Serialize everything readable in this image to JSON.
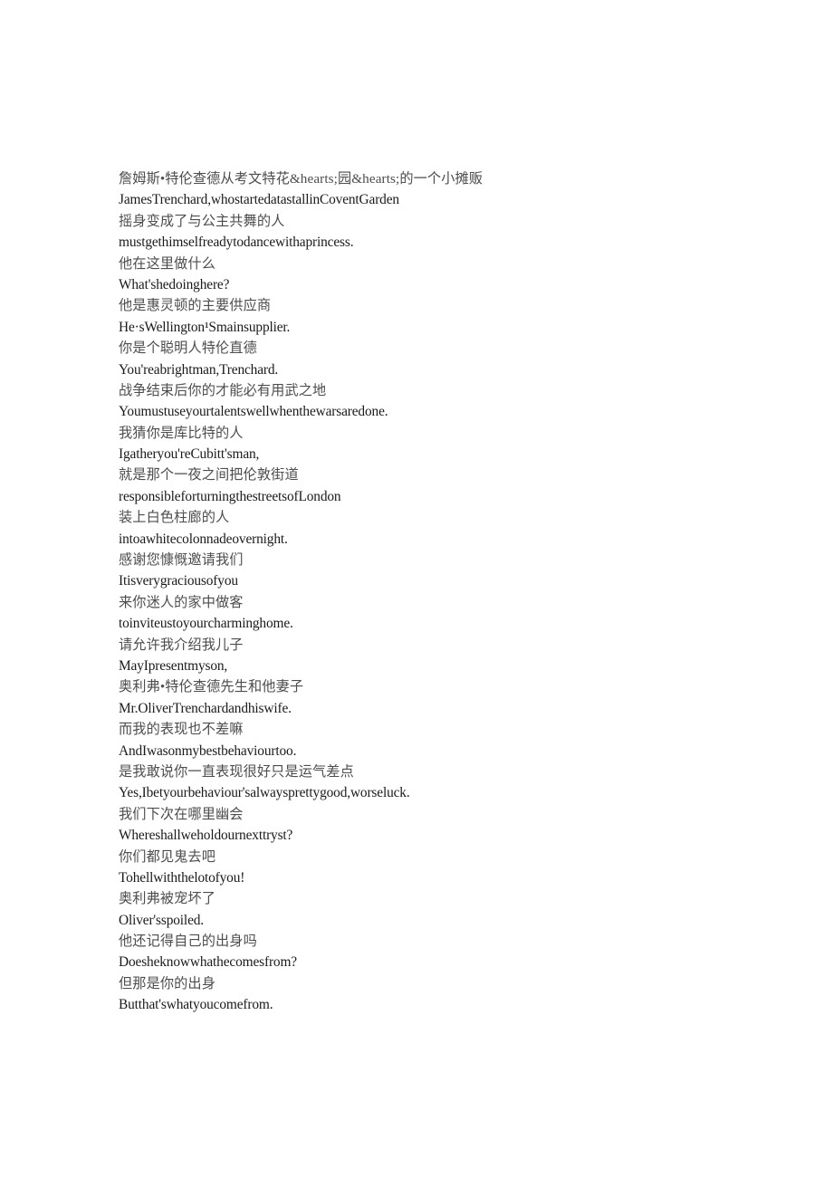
{
  "document": {
    "type": "bilingual-subtitle-transcript",
    "background_color": "#ffffff",
    "zh_text_color": "#4d4d4d",
    "en_text_color": "#1a1a1a",
    "lines": [
      {
        "lang": "zh",
        "text": "詹姆斯•特伦查德从考文特花&hearts;园&hearts;的一个小摊贩"
      },
      {
        "lang": "en",
        "text": "JamesTrenchard,whostartedatastallinCoventGarden"
      },
      {
        "lang": "zh",
        "text": "摇身变成了与公主共舞的人"
      },
      {
        "lang": "en",
        "text": "mustgethimselfreadytodancewithaprincess."
      },
      {
        "lang": "zh",
        "text": "他在这里做什么"
      },
      {
        "lang": "en",
        "text": "What'shedoinghere?"
      },
      {
        "lang": "zh",
        "text": "他是惠灵顿的主要供应商"
      },
      {
        "lang": "en",
        "text": "He·sWellington¹Smainsupplier."
      },
      {
        "lang": "zh",
        "text": "你是个聪明人特伦直德"
      },
      {
        "lang": "en",
        "text": "You'reabrightman,Trenchard."
      },
      {
        "lang": "zh",
        "text": "战争结束后你的才能必有用武之地"
      },
      {
        "lang": "en",
        "text": "Youmustuseyourtalentswellwhenthewarsaredone."
      },
      {
        "lang": "zh",
        "text": "我猜你是库比特的人"
      },
      {
        "lang": "en",
        "text": "Igatheryou'reCubitt'sman,"
      },
      {
        "lang": "zh",
        "text": "就是那个一夜之间把伦敦街道"
      },
      {
        "lang": "en",
        "text": "responsibleforturningthestreetsofLondon"
      },
      {
        "lang": "zh",
        "text": "装上白色柱廊的人"
      },
      {
        "lang": "en",
        "text": "intoawhitecolonnadeovernight."
      },
      {
        "lang": "zh",
        "text": "感谢您慷慨邀请我们"
      },
      {
        "lang": "en",
        "text": "Itisverygraciousofyou"
      },
      {
        "lang": "zh",
        "text": "来你迷人的家中做客"
      },
      {
        "lang": "en",
        "text": "toinviteustoyourcharminghome."
      },
      {
        "lang": "zh",
        "text": "请允许我介绍我儿子"
      },
      {
        "lang": "en",
        "text": "MayIpresentmyson,"
      },
      {
        "lang": "zh",
        "text": "奥利弗•特伦查德先生和他妻子"
      },
      {
        "lang": "en",
        "text": "Mr.OliverTrenchardandhiswife."
      },
      {
        "lang": "zh",
        "text": "而我的表现也不差嘛"
      },
      {
        "lang": "en",
        "text": "AndIwasonmybestbehaviourtoo."
      },
      {
        "lang": "zh",
        "text": "是我敢说你一直表现很好只是运气差点"
      },
      {
        "lang": "en",
        "text": "Yes,Ibetyourbehaviour'salwaysprettygood,worseluck."
      },
      {
        "lang": "zh",
        "text": "我们下次在哪里幽会"
      },
      {
        "lang": "en",
        "text": "Whereshallweholdournexttryst?"
      },
      {
        "lang": "zh",
        "text": "你们都见鬼去吧"
      },
      {
        "lang": "en",
        "text": "Tohellwiththelotofyou!"
      },
      {
        "lang": "zh",
        "text": "奥利弗被宠坏了"
      },
      {
        "lang": "en",
        "text": "Oliver'sspoiled."
      },
      {
        "lang": "zh",
        "text": "他还记得自己的出身吗"
      },
      {
        "lang": "en",
        "text": "Doesheknowwhathecomesfrom?"
      },
      {
        "lang": "zh",
        "text": "但那是你的出身"
      },
      {
        "lang": "en",
        "text": "Butthat'swhatyoucomefrom."
      }
    ]
  }
}
